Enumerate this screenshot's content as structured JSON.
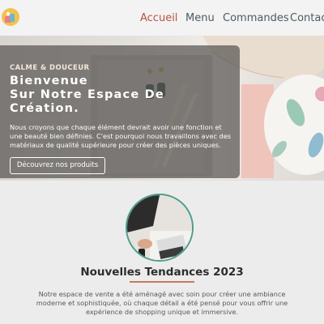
{
  "nav": {
    "links": [
      {
        "label": "Accueil",
        "active": true
      },
      {
        "label": "Menu",
        "active": false
      },
      {
        "label": "Commandes",
        "active": false
      },
      {
        "label": "Contact",
        "active": false
      }
    ]
  },
  "hero": {
    "kicker": "CALME & DOUCEUR",
    "headline_lines": [
      "Bienvenue",
      "Sur Notre Espace De",
      "Création."
    ],
    "description_lines": [
      "Nous croyons que chaque élément devrait avoir une fonction et",
      "une beauté bien définies. C'est pourquoi nous travaillons avec des",
      "matériaux de qualité supérieure pour créer des pièces uniques."
    ],
    "cta_label": "Découvrez nos produits"
  },
  "section": {
    "title": "Nouvelles Tendances 2023",
    "text_lines": [
      "Notre espace de vente a été aménagé avec soin pour créer une ambiance",
      "moderne et sophistiquée, où chaque détail a été pensé pour vous offrir une",
      "expérience de shopping unique et immersive."
    ]
  },
  "colors": {
    "accent": "#b5533f",
    "nav_text": "#4f5a63",
    "avatar_ring": "#4e9c8e",
    "title_underline": "#c67b56"
  },
  "icons": {
    "logo": "shop-logo-icon"
  }
}
